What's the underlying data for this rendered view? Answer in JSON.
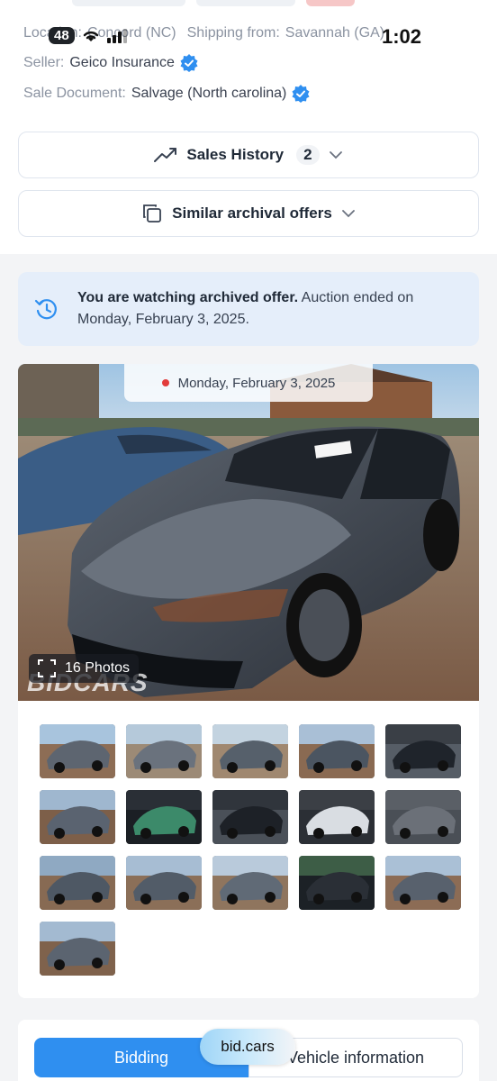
{
  "status_bar": {
    "battery": "48",
    "time": "1:02"
  },
  "info": {
    "location_label": "Location:",
    "location_value": "Concord (NC)",
    "shipping_label": "Shipping from:",
    "shipping_value": "Savannah (GA)",
    "seller_label": "Seller:",
    "seller_value": "Geico Insurance",
    "document_label": "Sale Document:",
    "document_value": "Salvage (North carolina)"
  },
  "sales_history": {
    "label": "Sales History",
    "count": "2"
  },
  "similar_offers": {
    "label": "Similar archival offers"
  },
  "archived_banner": {
    "bold": "You are watching archived offer.",
    "rest": " Auction ended on Monday, February 3, 2025."
  },
  "gallery": {
    "date": "Monday, February 3, 2025",
    "photos_label": "16 Photos",
    "watermark": "BIDCARS",
    "thumbnails": [
      "front-left",
      "front-right",
      "side",
      "rear",
      "interior-seats",
      "damage-front",
      "dashboard",
      "rear-seats",
      "vin-label",
      "door-panel",
      "front",
      "side-view",
      "side-right",
      "odometer",
      "rear-view",
      "front-left-2"
    ]
  },
  "tabs": {
    "bidding": "Bidding",
    "vehicle": "Vehicle information"
  },
  "site_pill": "bid.cars",
  "colors": {
    "accent": "#2f8ff0",
    "verified": "#2f8ff0",
    "banner_bg": "#e5eefa"
  }
}
